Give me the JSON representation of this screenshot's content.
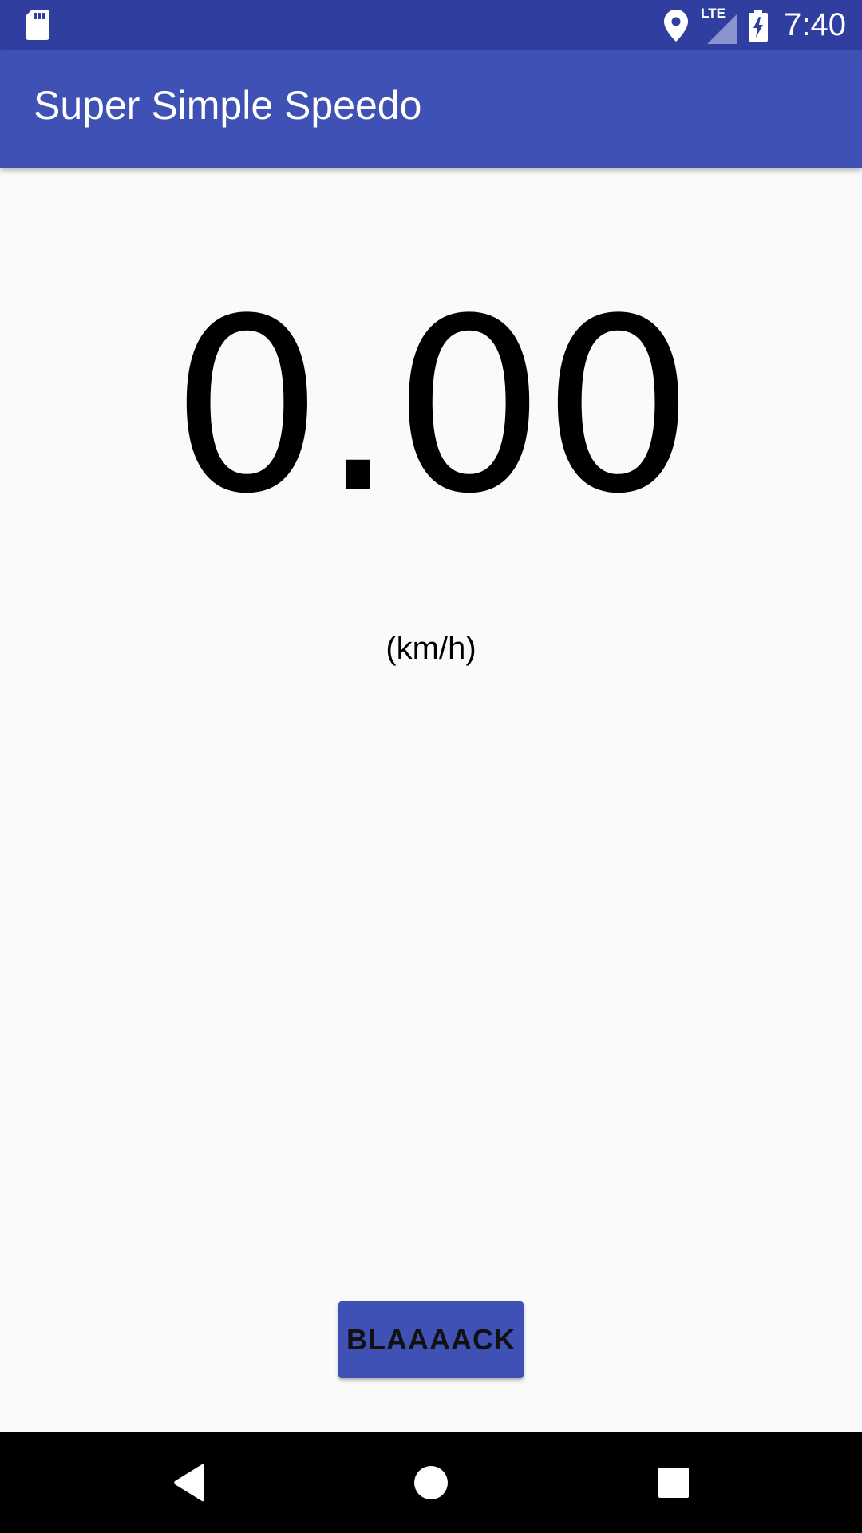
{
  "status_bar": {
    "time": "7:40",
    "network": "LTE",
    "icons": [
      "sd-card-icon",
      "location-pin-icon",
      "cell-signal-icon",
      "battery-charging-icon"
    ]
  },
  "app_bar": {
    "title": "Super Simple Speedo"
  },
  "speedometer": {
    "value": "0.00",
    "unit": "(km/h)"
  },
  "action_button": {
    "label": "BLAAAACK"
  },
  "nav_bar": {
    "icons": [
      "back-icon",
      "home-icon",
      "recents-icon"
    ]
  },
  "colors": {
    "status_bar": "#303f9f",
    "primary": "#3f51b5",
    "background": "#fafafa",
    "nav_bar": "#000000"
  }
}
